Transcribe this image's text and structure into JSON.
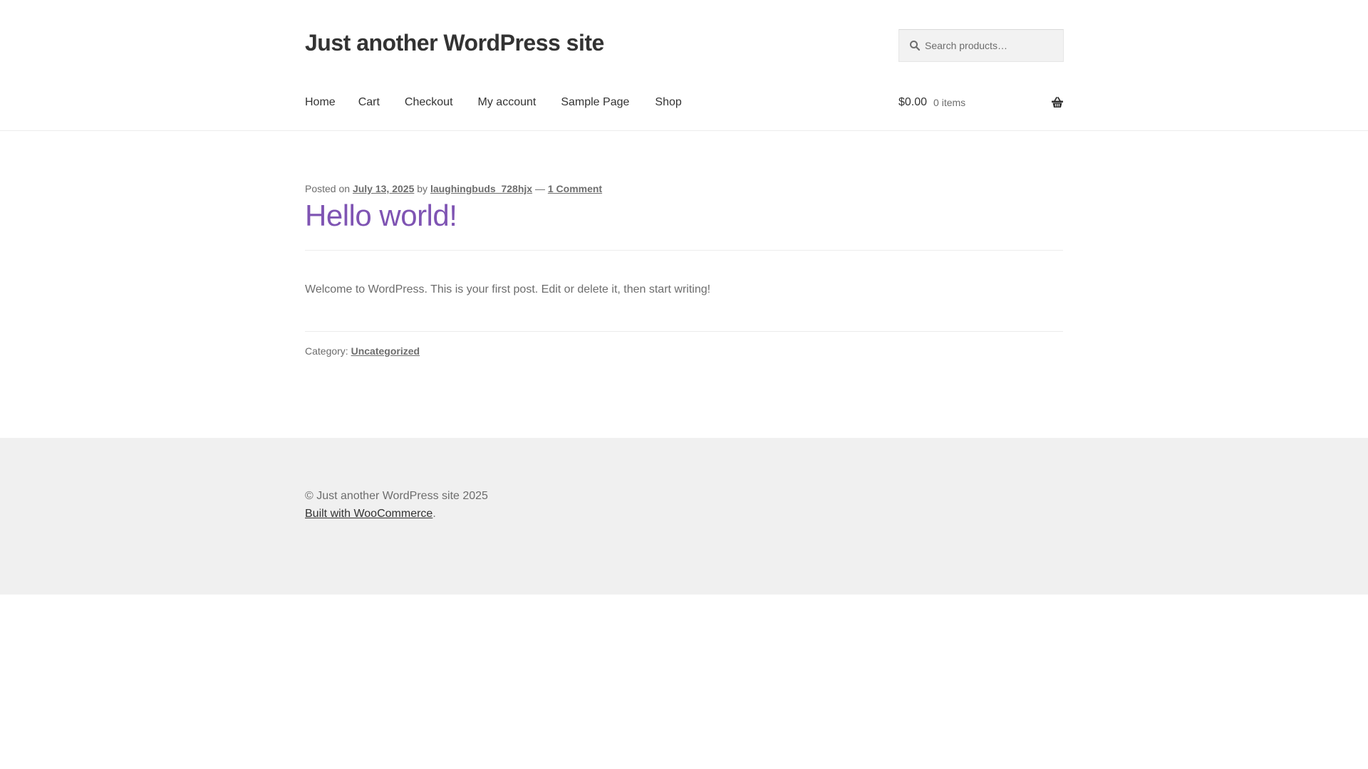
{
  "header": {
    "site_title": "Just another WordPress site",
    "search_placeholder": "Search products…"
  },
  "nav": {
    "items": [
      "Home",
      "Cart",
      "Checkout",
      "My account",
      "Sample Page",
      "Shop"
    ]
  },
  "cart": {
    "amount": "$0.00",
    "count": "0 items"
  },
  "post": {
    "meta_posted_on": "Posted on",
    "date": "July 13, 2025",
    "meta_by": "by",
    "author": "laughingbuds_728hjx",
    "meta_dash": "—",
    "comments": "1 Comment",
    "title": "Hello world!",
    "content": "Welcome to WordPress. This is your first post. Edit or delete it, then start writing!",
    "category_label": "Category:",
    "category": "Uncategorized"
  },
  "footer": {
    "copyright": "© Just another WordPress site 2025",
    "credit_link": "Built with WooCommerce",
    "credit_suffix": "."
  },
  "colors": {
    "accent": "#7f54b3",
    "heading": "#333333",
    "body_text": "#6d6d6d",
    "footer_bg": "#f0f0f0"
  },
  "icons": {
    "search": "search-icon",
    "cart": "shopping-basket-icon"
  }
}
